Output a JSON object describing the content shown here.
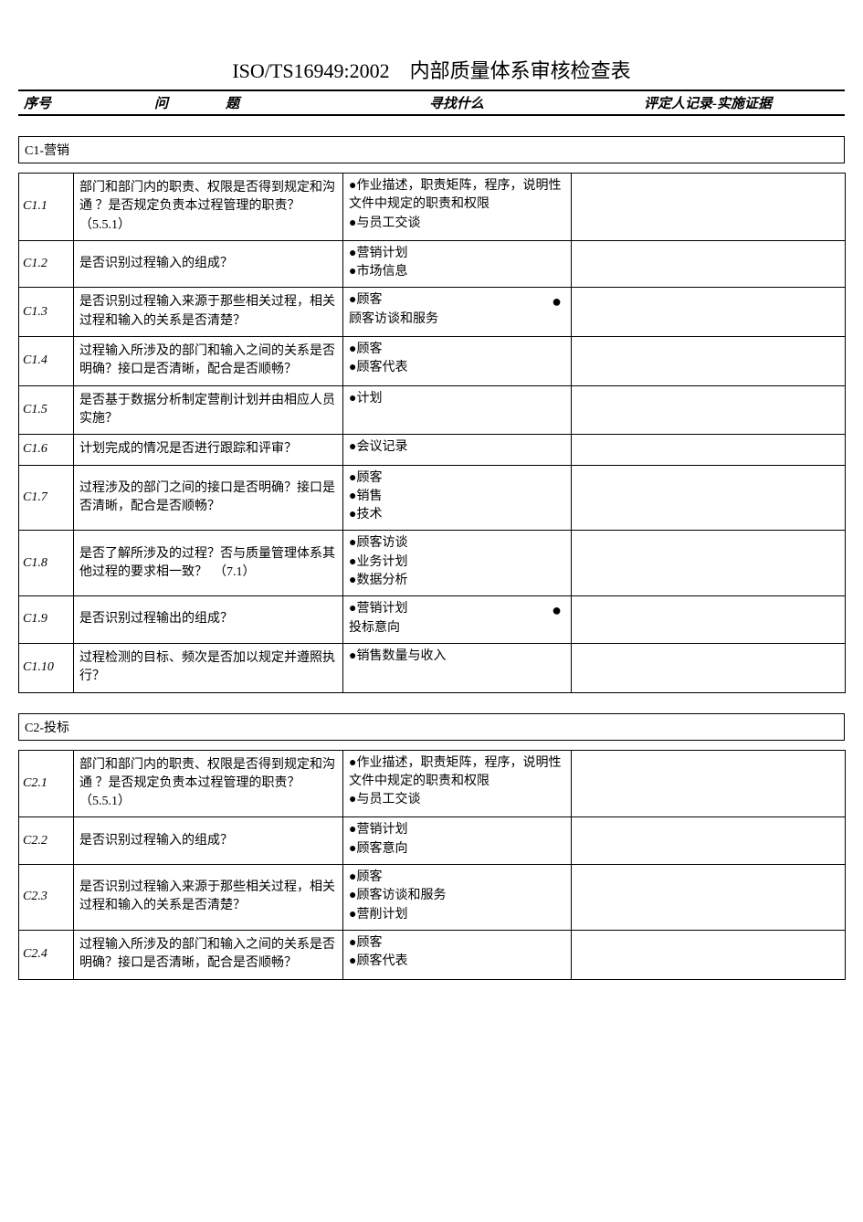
{
  "title": "ISO/TS16949:2002　内部质量体系审核检查表",
  "header": {
    "no": "序号",
    "question": "问　题",
    "find": "寻找什么",
    "evidence": "评定人记录-实施证据"
  },
  "sections": [
    {
      "label": "C1-营销",
      "rows": [
        {
          "no": "C1.1",
          "q": "部门和部门内的职责、权限是否得到规定和沟通 ？是否规定负责本过程管理的职责？　（5.5.1）",
          "find": [
            "●作业描述，职责矩阵，程序，说明性文件中规定的职责和权限",
            "●与员工交谈"
          ],
          "extraDot": false
        },
        {
          "no": "C1.2",
          "q": "是否识别过程输入的组成？",
          "find": [
            "●营销计划",
            "●市场信息"
          ],
          "extraDot": false
        },
        {
          "no": "C1.3",
          "q": "是否识别过程输入来源于那些相关过程，相关过程和输入的关系是否清楚？",
          "find": [
            "●顾客",
            "顾客访谈和服务"
          ],
          "extraDot": true
        },
        {
          "no": "C1.4",
          "q": "过程输入所涉及的部门和输入之间的关系是否明确？接口是否清晰，配合是否顺畅？",
          "find": [
            "●顾客",
            "●顾客代表"
          ],
          "extraDot": false
        },
        {
          "no": "C1.5",
          "q": "是否基于数据分析制定营削计划并由相应人员实施？",
          "find": [
            "●计划"
          ],
          "extraDot": false
        },
        {
          "no": "C1.6",
          "q": "计划完成的情况是否进行跟踪和评审？",
          "find": [
            "●会议记录"
          ],
          "extraDot": false
        },
        {
          "no": "C1.7",
          "q": "过程涉及的部门之间的接口是否明确？接口是否清晰，配合是否顺畅？",
          "find": [
            "●顾客",
            "●销售",
            "●技术"
          ],
          "extraDot": false
        },
        {
          "no": "C1.8",
          "q": "是否了解所涉及的过程？否与质量管理体系其他过程的要求相一致？　（7.1）",
          "find": [
            "●顾客访谈",
            "●业务计划",
            "●数据分析"
          ],
          "extraDot": false
        },
        {
          "no": "C1.9",
          "q": "是否识别过程输出的组成？",
          "find": [
            "●营销计划",
            "投标意向"
          ],
          "extraDot": true
        },
        {
          "no": "C1.10",
          "q": "过程检测的目标、频次是否加以规定并遵照执行？",
          "find": [
            "●销售数量与收入"
          ],
          "extraDot": false
        }
      ]
    },
    {
      "label": "C2-投标",
      "rows": [
        {
          "no": "C2.1",
          "q": "部门和部门内的职责、权限是否得到规定和沟通 ？是否规定负责本过程管理的职责？　（5.5.1）",
          "find": [
            "●作业描述，职责矩阵，程序，说明性文件中规定的职责和权限",
            "●与员工交谈"
          ],
          "extraDot": false
        },
        {
          "no": "C2.2",
          "q": "是否识别过程输入的组成？",
          "find": [
            "●营销计划",
            "●顾客意向"
          ],
          "extraDot": false
        },
        {
          "no": "C2.3",
          "q": "是否识别过程输入来源于那些相关过程，相关过程和输入的关系是否清楚？",
          "find": [
            "●顾客",
            "●顾客访谈和服务",
            "●营削计划"
          ],
          "extraDot": false
        },
        {
          "no": "C2.4",
          "q": "过程输入所涉及的部门和输入之间的关系是否明确？接口是否清晰，配合是否顺畅？",
          "find": [
            "●顾客",
            "●顾客代表"
          ],
          "extraDot": false
        }
      ]
    }
  ]
}
